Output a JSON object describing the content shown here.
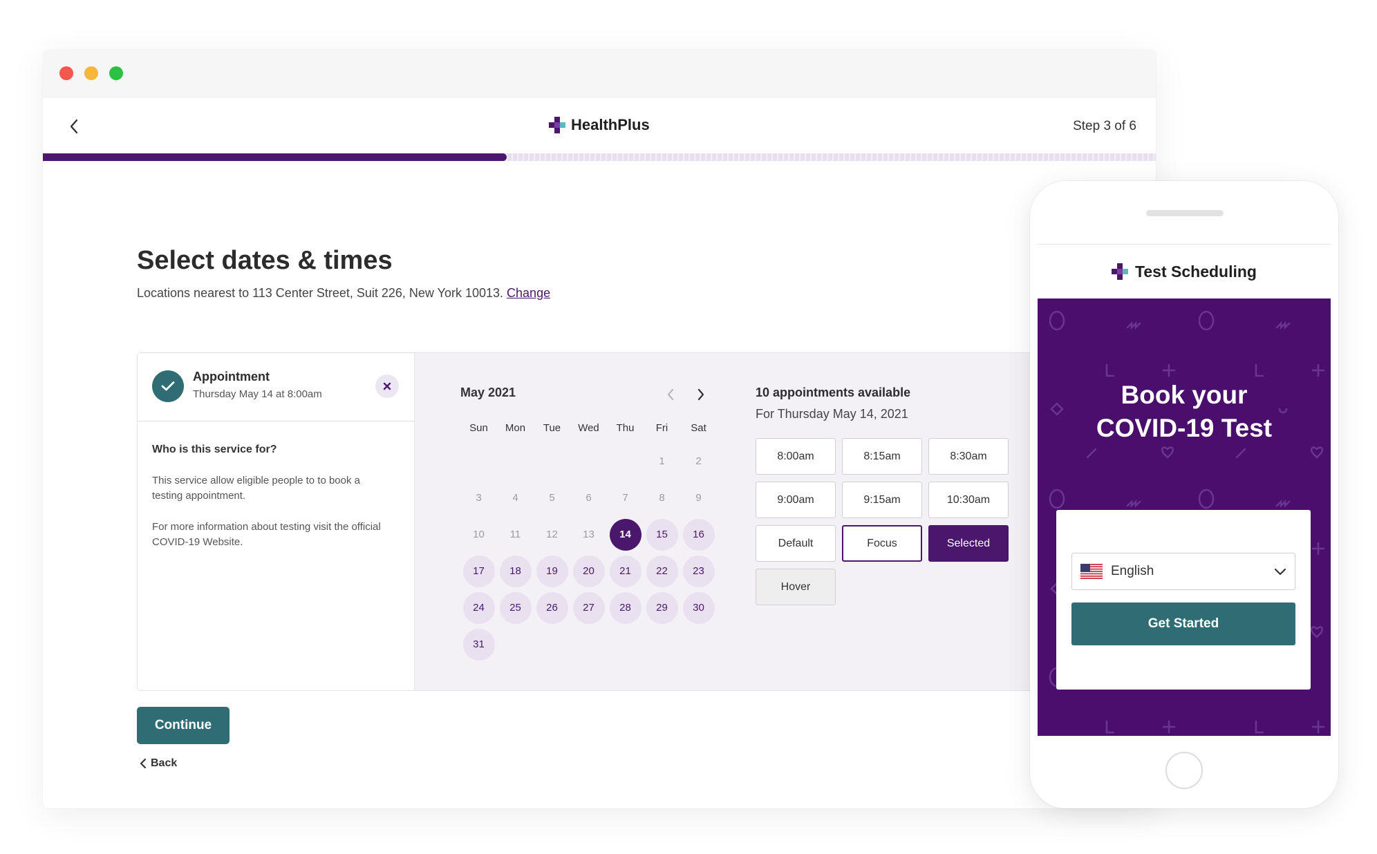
{
  "header": {
    "brand_name": "HealthPlus",
    "step_text": "Step 3 of 6",
    "progress_fraction": 0.417
  },
  "page": {
    "title": "Select dates & times",
    "subtitle": "Locations nearest to 113 Center Street, Suit 226, New York 10013.",
    "change_link": "Change"
  },
  "appointment": {
    "title": "Appointment",
    "summary": "Thursday May 14 at 8:00am",
    "question": "Who is this service for?",
    "desc1": "This service allow eligible people to to book a testing appointment.",
    "desc2": "For more information about testing visit the official COVID-19 Website."
  },
  "calendar": {
    "month_label": "May 2021",
    "weekdays": [
      "Sun",
      "Mon",
      "Tue",
      "Wed",
      "Thu",
      "Fri",
      "Sat"
    ],
    "leading_blanks": 5,
    "days_in_month": 31,
    "selected_day": 14,
    "first_available_day": 14
  },
  "slots": {
    "title": "10 appointments available",
    "subtitle": "For Thursday May 14, 2021",
    "items": [
      {
        "label": "8:00am",
        "state": "default"
      },
      {
        "label": "8:15am",
        "state": "default"
      },
      {
        "label": "8:30am",
        "state": "default"
      },
      {
        "label": "9:00am",
        "state": "default"
      },
      {
        "label": "9:15am",
        "state": "default"
      },
      {
        "label": "10:30am",
        "state": "default"
      },
      {
        "label": "Default",
        "state": "default"
      },
      {
        "label": "Focus",
        "state": "focus"
      },
      {
        "label": "Selected",
        "state": "selected"
      },
      {
        "label": "Hover",
        "state": "hover"
      }
    ]
  },
  "footer": {
    "continue_label": "Continue",
    "back_label": "Back"
  },
  "phone": {
    "header_title": "Test Scheduling",
    "hero_title_line1": "Book your",
    "hero_title_line2": "COVID-19 Test",
    "language_value": "English",
    "get_started_label": "Get Started"
  },
  "colors": {
    "brand_purple": "#4a176d",
    "teal": "#2f6d75",
    "hero_purple": "#4a0f6d"
  }
}
